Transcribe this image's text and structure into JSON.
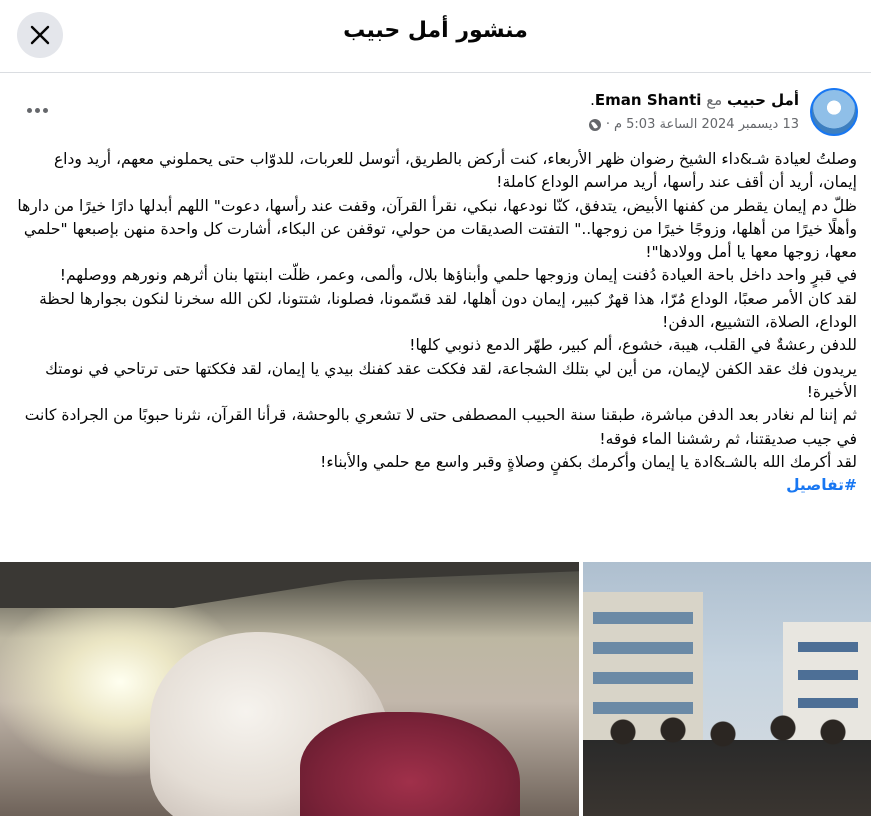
{
  "header": {
    "title": "منشور أمل حبيب",
    "close_icon": "close-icon"
  },
  "post": {
    "author": "أمل حبيب",
    "with_word": "مع",
    "tagged": "Eman Shanti",
    "period": ".",
    "timestamp": "13 ديسمبر 2024 الساعة 5:03 م",
    "separator": "·",
    "audience_icon": "globe-icon",
    "more_icon": "more-options-icon",
    "paragraphs": [
      "وصلتُ لعيادة شـ&داء الشيخ رضوان ظهر الأربعاء، كنت أركض بالطريق، أتوسل للعربات، للدوّاب حتى يحملوني معهم، أريد وداع إيمان، أريد أن أقف عند رأسها، أريد مراسم الوداع كاملة!",
      "ظلّ دم إيمان يقطر من كفنها الأبيض، يتدفق، كنّا نودعها، نبكي، نقرأ القرآن، وقفت عند رأسها، دعوت\" اللهم أبدلها دارًا خيرًا من دارها وأهلًا خيرًا من أهلها، وزوجًا خيرًا من زوجها..\" التفتت الصديقات من حولي، توقفن عن البكاء، أشارت كل واحدة منهن بإصبعها \"حلمي معها، زوجها معها يا أمل وولادها\"!",
      "في قبرٍ واحد داخل باحة العيادة دُفنت إيمان وزوجها حلمي وأبناؤها بلال، وألمى، وعمر، ظلّت ابنتها بنان أثرهم ونورهم ووصلهم!",
      "لقد كان الأمر صعبًا، الوداع مُرّا، هذا قهرٌ كبير، إيمان دون أهلها، لقد قسّمونا، فصلونا، شتتونا، لكن الله سخرنا لنكون بجوارها لحظة الوداع، الصلاة، التشييع، الدفن!",
      "للدفن رعشةٌ في القلب، هيبة، خشوع، ألم كبير، طهّر الدمع ذنوبي كلها!",
      "يريدون فك عقد الكفن لإيمان، من أين لي بتلك الشجاعة، لقد فككت عقد كفنك بيدي يا إيمان، لقد فككتها حتى ترتاحي في نومتك الأخيرة!",
      "ثم إننا لم نغادر بعد الدفن مباشرة، طبقنا سنة الحبيب المصطفى حتى لا تشعري بالوحشة، قرأنا القرآن، نثرنا حبوبًا من الجرادة كانت في جيب صديقتنا، ثم رششنا الماء فوقه!",
      "لقد أكرمك الله بالشـ&ادة يا إيمان وأكرمك بكفنٍ وصلاةٍ وقبر واسع مع حلمي والأبناء!"
    ],
    "hashtag": "#تفاصيل"
  }
}
